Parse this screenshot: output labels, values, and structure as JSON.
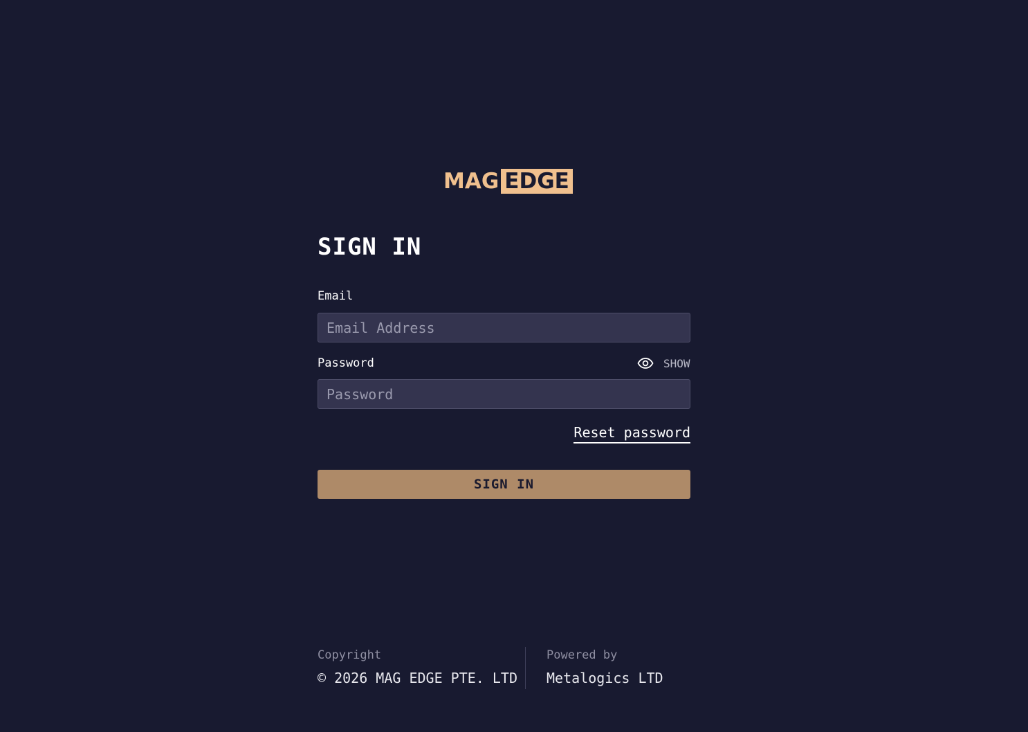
{
  "logo": {
    "part1": "MAG",
    "part2": "EDGE"
  },
  "title": "SIGN IN",
  "email": {
    "label": "Email",
    "placeholder": "Email Address",
    "value": ""
  },
  "password": {
    "label": "Password",
    "placeholder": "Password",
    "value": "",
    "toggle_label": "SHOW",
    "toggle_icon": "eye-icon"
  },
  "reset_link": "Reset password",
  "submit_label": "SIGN IN",
  "footer": {
    "copyright_label": "Copyright",
    "copyright_value": "© 2026 MAG EDGE PTE. LTD",
    "powered_label": "Powered by",
    "powered_value": "Metalogics LTD"
  },
  "colors": {
    "background": "#181a30",
    "accent": "#ae8a68",
    "logo": "#f0c08e",
    "input_bg": "#34344f"
  }
}
